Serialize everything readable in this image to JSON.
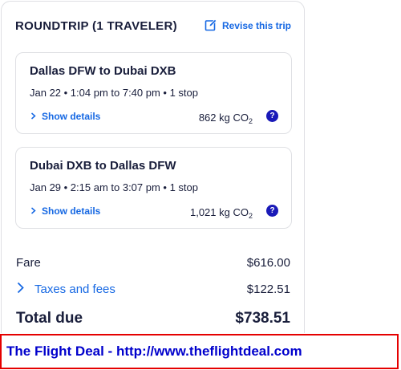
{
  "summary": {
    "title": "ROUNDTRIP (1 TRAVELER)",
    "revise_label": "Revise this trip"
  },
  "legs": [
    {
      "route": "Dallas DFW to Dubai DXB",
      "time": "Jan 22 • 1:04 pm to 7:40 pm • 1 stop",
      "show_details_label": "Show details",
      "co2_amount": "862 kg CO",
      "co2_sub": "2",
      "help_label": "?"
    },
    {
      "route": "Dubai DXB to Dallas DFW",
      "time": "Jan 29 • 2:15 am to 3:07 pm • 1 stop",
      "show_details_label": "Show details",
      "co2_amount": "1,021 kg CO",
      "co2_sub": "2",
      "help_label": "?"
    }
  ],
  "price": {
    "fare_label": "Fare",
    "fare_value": "$616.00",
    "taxes_label": "Taxes and fees",
    "taxes_value": "$122.51",
    "total_label": "Total due",
    "total_value": "$738.51"
  },
  "banner": {
    "text": "The Flight Deal - http://www.theflightdeal.com"
  },
  "colors": {
    "link_blue": "#1668e3",
    "help_badge": "#1a1ab8",
    "text_dark": "#191e3b",
    "banner_border": "#e50000",
    "banner_text": "#0000cc"
  },
  "icons": {
    "revise": "edit-icon",
    "show_details": "chevron-right-icon",
    "taxes": "chevron-right-icon",
    "help": "help-icon"
  }
}
